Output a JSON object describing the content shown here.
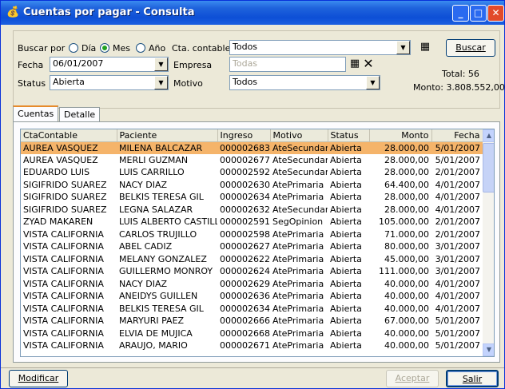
{
  "window": {
    "title": "Cuentas por pagar - Consulta",
    "app_icon": "money-bag-icon"
  },
  "filters": {
    "buscar_por_label": "Buscar por",
    "radios": [
      {
        "label": "Día",
        "checked": false
      },
      {
        "label": "Mes",
        "checked": true
      },
      {
        "label": "Año",
        "checked": false
      }
    ],
    "cta_contable_label": "Cta. contable",
    "cta_contable_value": "Todos",
    "buscar_label": "Buscar",
    "fecha_label": "Fecha",
    "fecha_value": "06/01/2007",
    "empresa_label": "Empresa",
    "empresa_value": "Todas",
    "status_label": "Status",
    "status_value": "Abierta",
    "motivo_label": "Motivo",
    "motivo_value": "Todos",
    "total_label": "Total: 56",
    "monto_label": "Monto: 3.808.552,00"
  },
  "tabs": [
    {
      "label": "Cuentas",
      "active": true
    },
    {
      "label": "Detalle",
      "active": false
    }
  ],
  "table": {
    "columns": [
      "CtaContable",
      "Paciente",
      "Ingreso",
      "Motivo",
      "Status",
      "Monto",
      "Fecha"
    ],
    "rows": [
      [
        "AUREA VASQUEZ",
        "MILENA BALCAZAR",
        "000002683",
        "AteSecundaria",
        "Abierta",
        "28.000,00",
        "5/01/2007"
      ],
      [
        "AUREA VASQUEZ",
        "MERLI GUZMAN",
        "000002677",
        "AteSecundaria",
        "Abierta",
        "28.000,00",
        "5/01/2007"
      ],
      [
        "EDUARDO LUIS",
        "LUIS CARRILLO",
        "000002592",
        "AteSecundaria",
        "Abierta",
        "28.000,00",
        "2/01/2007"
      ],
      [
        "SIGIFRIDO SUAREZ",
        "NACY DIAZ",
        "000002630",
        "AtePrimaria",
        "Abierta",
        "64.400,00",
        "4/01/2007"
      ],
      [
        "SIGIFRIDO SUAREZ",
        "BELKIS TERESA GIL",
        "000002634",
        "AtePrimaria",
        "Abierta",
        "28.000,00",
        "4/01/2007"
      ],
      [
        "SIGIFRIDO SUAREZ",
        "LEGNA SALAZAR",
        "000002632",
        "AteSecundaria",
        "Abierta",
        "28.000,00",
        "4/01/2007"
      ],
      [
        "ZYAD MAKAREN",
        "LUIS ALBERTO CASTILLO",
        "000002591",
        "SegOpinion",
        "Abierta",
        "105.000,00",
        "2/01/2007"
      ],
      [
        "VISTA CALIFORNIA",
        "CARLOS TRUJILLO",
        "000002598",
        "AtePrimaria",
        "Abierta",
        "71.000,00",
        "2/01/2007"
      ],
      [
        "VISTA CALIFORNIA",
        "ABEL CADIZ",
        "000002627",
        "AtePrimaria",
        "Abierta",
        "80.000,00",
        "3/01/2007"
      ],
      [
        "VISTA CALIFORNIA",
        "MELANY GONZALEZ",
        "000002622",
        "AtePrimaria",
        "Abierta",
        "45.000,00",
        "3/01/2007"
      ],
      [
        "VISTA CALIFORNIA",
        "GUILLERMO MONROY",
        "000002624",
        "AtePrimaria",
        "Abierta",
        "111.000,00",
        "3/01/2007"
      ],
      [
        "VISTA CALIFORNIA",
        "NACY DIAZ",
        "000002629",
        "AtePrimaria",
        "Abierta",
        "40.000,00",
        "4/01/2007"
      ],
      [
        "VISTA CALIFORNIA",
        "ANEIDYS GUILLEN",
        "000002636",
        "AtePrimaria",
        "Abierta",
        "40.000,00",
        "4/01/2007"
      ],
      [
        "VISTA CALIFORNIA",
        "BELKIS TERESA GIL",
        "000002634",
        "AtePrimaria",
        "Abierta",
        "40.000,00",
        "4/01/2007"
      ],
      [
        "VISTA CALIFORNIA",
        "MARYURI  PAEZ",
        "000002666",
        "AtePrimaria",
        "Abierta",
        "67.000,00",
        "5/01/2007"
      ],
      [
        "VISTA CALIFORNIA",
        "ELVIA DE MUJICA",
        "000002668",
        "AtePrimaria",
        "Abierta",
        "40.000,00",
        "5/01/2007"
      ],
      [
        "VISTA CALIFORNIA",
        "ARAUJO, MARIO",
        "000002671",
        "AtePrimaria",
        "Abierta",
        "40.000,00",
        "5/01/2007"
      ]
    ],
    "selected_row": 0
  },
  "footer": {
    "modificar_label": "Modificar",
    "aceptar_label": "Aceptar",
    "salir_label": "Salir"
  }
}
